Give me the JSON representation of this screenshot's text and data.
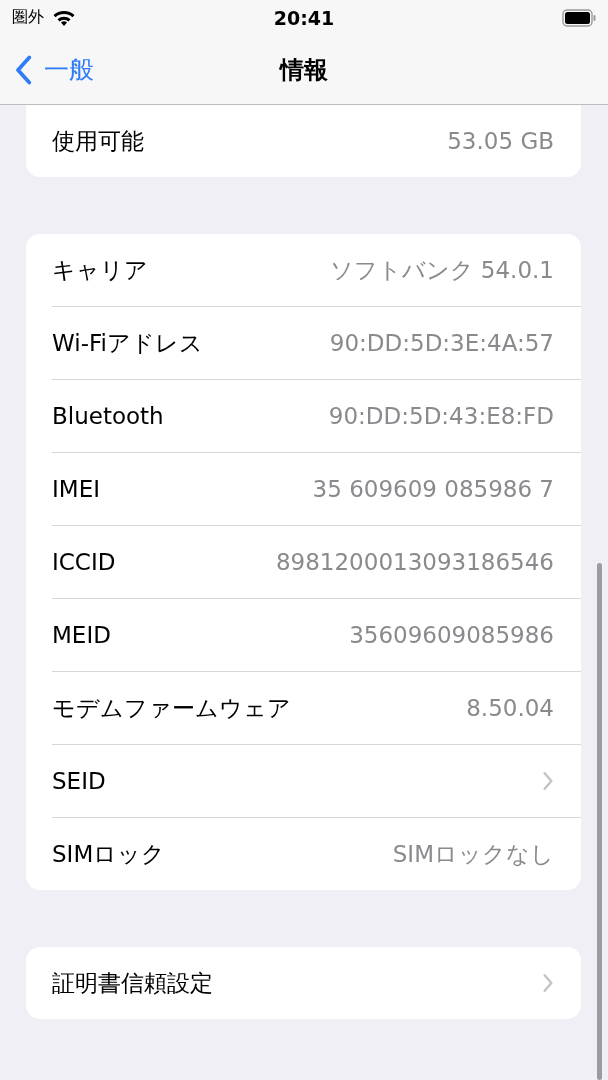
{
  "status_bar": {
    "carrier": "圏外",
    "time": "20:41"
  },
  "nav": {
    "back": "一般",
    "title": "情報"
  },
  "sections": [
    {
      "cut_top": true,
      "rows": [
        {
          "kind": "value",
          "label": "使用可能",
          "value": "53.05 GB"
        }
      ]
    },
    {
      "cut_top": false,
      "rows": [
        {
          "kind": "value",
          "label": "キャリア",
          "value": "ソフトバンク 54.0.1"
        },
        {
          "kind": "value",
          "label": "Wi-Fiアドレス",
          "value": "90:DD:5D:3E:4A:57"
        },
        {
          "kind": "value",
          "label": "Bluetooth",
          "value": "90:DD:5D:43:E8:FD"
        },
        {
          "kind": "value",
          "label": "IMEI",
          "value": "35 609609 085986 7"
        },
        {
          "kind": "value",
          "label": "ICCID",
          "value": "8981200013093186546"
        },
        {
          "kind": "value",
          "label": "MEID",
          "value": "35609609085986"
        },
        {
          "kind": "value",
          "label": "モデムファームウェア",
          "value": "8.50.04"
        },
        {
          "kind": "link",
          "label": "SEID"
        },
        {
          "kind": "value",
          "label": "SIMロック",
          "value": "SIMロックなし"
        }
      ]
    },
    {
      "cut_top": false,
      "rows": [
        {
          "kind": "link",
          "label": "証明書信頼設定"
        }
      ]
    }
  ]
}
